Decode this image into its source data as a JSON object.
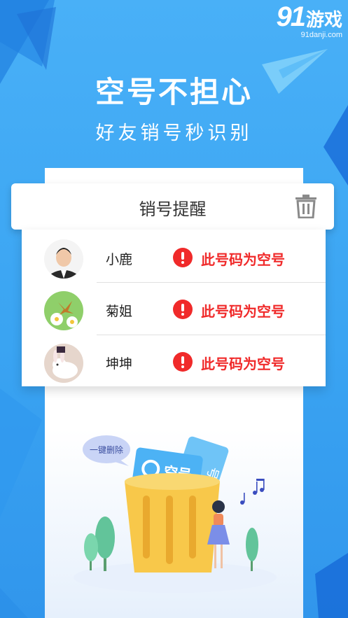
{
  "promo": {
    "headline": "空号不担心",
    "subline": "好友销号秒识别"
  },
  "watermark": {
    "brand_number": "91",
    "brand_cn": "游戏",
    "url": "91danji.com"
  },
  "card": {
    "title": "销号提醒",
    "action_icon": "trash-icon"
  },
  "contacts": [
    {
      "name": "小鹿",
      "status": "此号码为空号",
      "avatar": "man-portrait"
    },
    {
      "name": "菊姐",
      "status": "此号码为空号",
      "avatar": "butterfly-flower"
    },
    {
      "name": "坤坤",
      "status": "此号码为空号",
      "avatar": "rabbit-hat"
    }
  ],
  "illustration": {
    "bubble": "一键删除",
    "card_front": "空号",
    "card_back": "号"
  },
  "colors": {
    "background": "#3aa6f3",
    "warning": "#f02a2a",
    "card_blue": "#4cb2f5",
    "bin_yellow": "#f8c84a"
  }
}
